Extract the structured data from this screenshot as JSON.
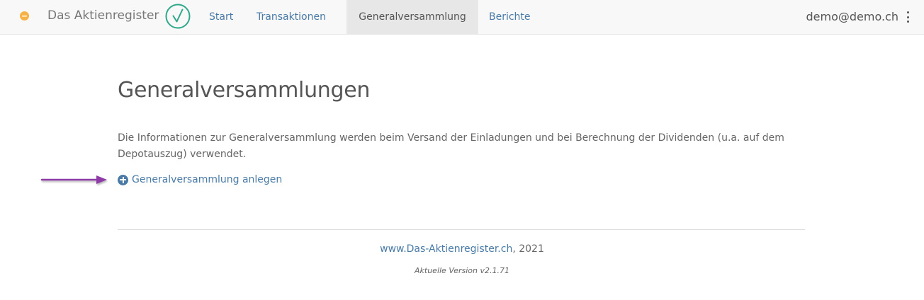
{
  "navbar": {
    "brand": "Das Aktienregister",
    "items": [
      {
        "label": "Start",
        "active": false
      },
      {
        "label": "Transaktionen",
        "active": false
      },
      {
        "label": "Generalversammlung",
        "active": true
      },
      {
        "label": "Berichte",
        "active": false
      }
    ],
    "user": "demo@demo.ch",
    "icons": {
      "logo": "logo-icon",
      "check": "check-circle-icon",
      "menu": "kebab-menu-icon"
    },
    "colors": {
      "link": "#4a7aa6",
      "check": "#2ea88a",
      "active_bg": "#e7e7e7"
    }
  },
  "main": {
    "title": "Generalversammlungen",
    "intro": "Die Informationen zur Generalversammlung werden beim Versand der Einladungen und bei Berechnung der Dividenden (u.a. auf dem Depotauszug) verwendet.",
    "add_link": "Generalversammlung anlegen",
    "annotation_arrow_color": "#8e3aa8"
  },
  "footer": {
    "link": "www.Das-Aktienregister.ch",
    "year_suffix": ", 2021",
    "version": "Aktuelle Version v2.1.71"
  }
}
